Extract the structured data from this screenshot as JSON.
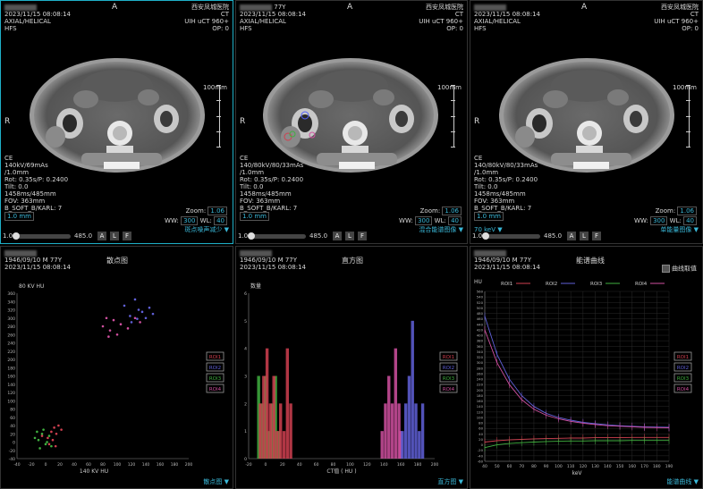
{
  "ct_views": [
    {
      "name_hidden": true,
      "orientation_top": "A",
      "orientation_left": "R",
      "hospital": "西安凤城医院",
      "modality": "CT",
      "scanner": "UIH uCT 960+",
      "op": "OP: 0",
      "date": "2023/11/15 08:08:14",
      "series": "AXIAL/HELICAL",
      "position": "HFS",
      "scale_label": "100mm",
      "params": [
        "CE",
        "140kV/69mAs",
        "/1.0mm",
        "Rot: 0.35s/P: 0.2400",
        "Tilt: 0.0",
        "1458ms/485mm",
        "FOV: 363mm",
        "B_SOFT_B/KARL: 7"
      ],
      "thickness": "1.0 mm",
      "zoom": "1.06",
      "ww": "300",
      "wl": "40",
      "slider_left": "1.0",
      "slider_right": "485.0",
      "buttons": [
        "A",
        "L",
        "F"
      ],
      "mode": "斑点噪声减少 ▼"
    },
    {
      "orientation_top": "A",
      "orientation_left": "R",
      "age": "77Y",
      "hospital": "西安凤城医院",
      "modality": "CT",
      "scanner": "UIH uCT 960+",
      "op": "OP: 0",
      "date": "2023/11/15 08:08:14",
      "series": "AXIAL/HELICAL",
      "position": "HFS",
      "scale_label": "100mm",
      "params": [
        "CE",
        "140/80kV/80/33mAs",
        "/1.0mm",
        "Rot: 0.35s/P: 0.2400",
        "Tilt: 0.0",
        "1458ms/485mm",
        "FOV: 363mm",
        "B_SOFT_B/KARL: 7"
      ],
      "thickness": "1.0 mm",
      "zoom": "1.06",
      "ww": "300",
      "wl": "40",
      "slider_left": "1.0",
      "slider_right": "485.0",
      "buttons": [
        "A",
        "L",
        "F"
      ],
      "mode": "混合能谱图像 ▼"
    },
    {
      "orientation_top": "A",
      "orientation_left": "R",
      "hospital": "西安凤城医院",
      "modality": "CT",
      "scanner": "UIH uCT 960+",
      "op": "OP: 0",
      "date": "2023/11/15 08:08:14",
      "series": "AXIAL/HELICAL",
      "position": "HFS",
      "scale_label": "100mm",
      "params": [
        "CE",
        "140/80kV/80/33mAs",
        "/1.0mm",
        "Rot: 0.35s/P: 0.2400",
        "Tilt: 0.0",
        "1458ms/485mm",
        "FOV: 363mm",
        "B_SOFT_B/KARL: 7"
      ],
      "thickness": "1.0 mm",
      "zoom": "1.06",
      "ww": "300",
      "wl": "40",
      "kev": "70 keV ▼",
      "slider_left": "1.0",
      "slider_right": "485.0",
      "buttons": [
        "A",
        "L",
        "F"
      ],
      "mode": "单能量图像 ▼"
    }
  ],
  "colors": {
    "roi1": "#d04050",
    "roi2": "#6060d8",
    "roi3": "#40b040",
    "roi4": "#d050a0",
    "accent": "#3ab8d8"
  },
  "bottom_panels": {
    "patient_line": "1946/09/10 M 77Y",
    "date": "2023/11/15 08:08:14",
    "scatter_title": "散点图",
    "histogram_title": "直方图",
    "curve_title": "能谱曲线",
    "curve_checkbox": "曲线取值",
    "scatter_menu": "散点图 ▼",
    "histogram_menu": "直方图 ▼",
    "curve_menu": "能谱曲线 ▼",
    "roi_labels": [
      "ROI1",
      "ROI2",
      "ROI3",
      "ROI4"
    ]
  },
  "chart_data": [
    {
      "type": "scatter",
      "title": "散点图",
      "xlabel": "140 KV HU",
      "ylabel": "80 KV HU",
      "xlim": [
        -40,
        200
      ],
      "ylim": [
        -40,
        360
      ],
      "xticks": [
        -40,
        -20,
        0,
        20,
        40,
        60,
        80,
        100,
        120,
        140,
        160,
        180,
        200
      ],
      "yticks": [
        -40,
        -20,
        0,
        20,
        40,
        60,
        80,
        100,
        120,
        140,
        160,
        180,
        200,
        220,
        240,
        260,
        280,
        300,
        320,
        340,
        360
      ],
      "series": [
        {
          "name": "ROI1",
          "points": [
            [
              3,
              10
            ],
            [
              8,
              25
            ],
            [
              12,
              35
            ],
            [
              15,
              20
            ],
            [
              10,
              5
            ],
            [
              18,
              40
            ],
            [
              5,
              -5
            ],
            [
              22,
              30
            ],
            [
              -5,
              15
            ],
            [
              14,
              -10
            ]
          ]
        },
        {
          "name": "ROI2",
          "points": [
            [
              110,
              330
            ],
            [
              118,
              305
            ],
            [
              125,
              345
            ],
            [
              130,
              320
            ],
            [
              140,
              300
            ],
            [
              135,
              315
            ],
            [
              145,
              325
            ],
            [
              120,
              290
            ],
            [
              128,
              298
            ],
            [
              150,
              310
            ]
          ]
        },
        {
          "name": "ROI3",
          "points": [
            [
              -10,
              5
            ],
            [
              -5,
              20
            ],
            [
              0,
              -5
            ],
            [
              -15,
              10
            ],
            [
              5,
              15
            ],
            [
              -8,
              -15
            ],
            [
              2,
              0
            ],
            [
              -12,
              25
            ],
            [
              8,
              -10
            ],
            [
              -3,
              30
            ]
          ]
        },
        {
          "name": "ROI4",
          "points": [
            [
              80,
              280
            ],
            [
              85,
              300
            ],
            [
              90,
              270
            ],
            [
              95,
              295
            ],
            [
              100,
              260
            ],
            [
              105,
              285
            ],
            [
              115,
              275
            ],
            [
              125,
              300
            ],
            [
              88,
              255
            ],
            [
              132,
              290
            ]
          ]
        }
      ],
      "legend": "right"
    },
    {
      "type": "bar",
      "title": "直方图",
      "xlabel": "CT值 ( HU )",
      "ylabel": "数量",
      "xlim": [
        -20,
        200
      ],
      "ylim": [
        0,
        6
      ],
      "xticks": [
        -20,
        0,
        20,
        40,
        60,
        80,
        100,
        120,
        140,
        160,
        180,
        200
      ],
      "yticks": [
        0,
        1,
        2,
        3,
        4,
        5,
        6
      ],
      "series": [
        {
          "name": "ROI1",
          "bins": [
            [
              -8,
              2
            ],
            [
              -4,
              3
            ],
            [
              0,
              4
            ],
            [
              4,
              2
            ],
            [
              8,
              3
            ],
            [
              12,
              1
            ],
            [
              16,
              2
            ],
            [
              20,
              1
            ],
            [
              24,
              4
            ],
            [
              28,
              2
            ]
          ]
        },
        {
          "name": "ROI2",
          "bins": [
            [
              160,
              1
            ],
            [
              164,
              2
            ],
            [
              168,
              3
            ],
            [
              172,
              5
            ],
            [
              176,
              2
            ],
            [
              180,
              1
            ],
            [
              184,
              2
            ]
          ]
        },
        {
          "name": "ROI3",
          "bins": [
            [
              -10,
              3
            ],
            [
              -6,
              2
            ],
            [
              -2,
              3
            ],
            [
              2,
              1
            ],
            [
              6,
              2
            ],
            [
              10,
              3
            ],
            [
              14,
              1
            ]
          ]
        },
        {
          "name": "ROI4",
          "bins": [
            [
              136,
              1
            ],
            [
              140,
              2
            ],
            [
              144,
              3
            ],
            [
              148,
              2
            ],
            [
              152,
              4
            ],
            [
              156,
              2
            ],
            [
              158,
              1
            ]
          ]
        }
      ],
      "legend": "right"
    },
    {
      "type": "line",
      "title": "能谱曲线",
      "xlabel": "keV",
      "ylabel": "HU",
      "xlim": [
        40,
        190
      ],
      "ylim": [
        -60,
        560
      ],
      "xticks": [
        40,
        50,
        60,
        70,
        80,
        90,
        100,
        110,
        120,
        130,
        140,
        150,
        160,
        170,
        180,
        190
      ],
      "yticks": [
        -60,
        -40,
        -20,
        0,
        20,
        40,
        60,
        80,
        100,
        120,
        140,
        160,
        180,
        200,
        220,
        240,
        260,
        280,
        300,
        320,
        340,
        360,
        380,
        400,
        420,
        440,
        460,
        480,
        500,
        520,
        540,
        560
      ],
      "x": [
        40,
        50,
        60,
        70,
        80,
        90,
        100,
        110,
        120,
        130,
        140,
        150,
        160,
        170,
        180,
        190
      ],
      "series": [
        {
          "name": "ROI1",
          "values": [
            10,
            15,
            18,
            20,
            22,
            23,
            24,
            25,
            25,
            26,
            26,
            26,
            27,
            27,
            27,
            27
          ]
        },
        {
          "name": "ROI2",
          "values": [
            470,
            330,
            240,
            180,
            140,
            115,
            100,
            90,
            82,
            77,
            73,
            70,
            68,
            66,
            65,
            64
          ]
        },
        {
          "name": "ROI3",
          "values": [
            -10,
            0,
            5,
            8,
            10,
            12,
            13,
            14,
            14,
            15,
            15,
            15,
            16,
            16,
            16,
            16
          ]
        },
        {
          "name": "ROI4",
          "values": [
            420,
            300,
            220,
            165,
            130,
            108,
            95,
            86,
            79,
            74,
            70,
            68,
            66,
            64,
            63,
            62
          ]
        }
      ],
      "legend_top": [
        "ROI1",
        "ROI2",
        "ROI3",
        "ROI4"
      ]
    }
  ]
}
